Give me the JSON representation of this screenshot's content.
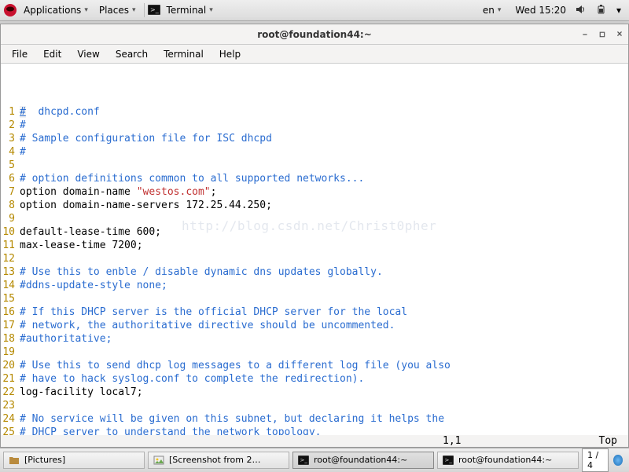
{
  "panel": {
    "applications": "Applications",
    "places": "Places",
    "terminal": "Terminal",
    "lang": "en",
    "clock": "Wed 15:20"
  },
  "window": {
    "title": "root@foundation44:~",
    "menu": {
      "file": "File",
      "edit": "Edit",
      "view": "View",
      "search": "Search",
      "terminal": "Terminal",
      "help": "Help"
    },
    "btn": {
      "min": "–",
      "max": "◻",
      "close": "×"
    }
  },
  "vim": {
    "status_pos": "1,1",
    "status_top": "Top",
    "watermark": "http://blog.csdn.net/Christ0pher",
    "lines": [
      {
        "n": "1",
        "segs": [
          {
            "t": "#",
            "c": "comment cursor-cell"
          },
          {
            "t": "  dhcpd.conf",
            "c": "comment"
          }
        ]
      },
      {
        "n": "2",
        "segs": [
          {
            "t": "#",
            "c": "comment"
          }
        ]
      },
      {
        "n": "3",
        "segs": [
          {
            "t": "# Sample configuration file for ISC dhcpd",
            "c": "comment"
          }
        ]
      },
      {
        "n": "4",
        "segs": [
          {
            "t": "#",
            "c": "comment"
          }
        ]
      },
      {
        "n": "5",
        "segs": [
          {
            "t": " ",
            "c": ""
          }
        ]
      },
      {
        "n": "6",
        "segs": [
          {
            "t": "# option definitions common to all supported networks...",
            "c": "comment"
          }
        ]
      },
      {
        "n": "7",
        "segs": [
          {
            "t": "option domain-name ",
            "c": ""
          },
          {
            "t": "\"westos.com\"",
            "c": "string"
          },
          {
            "t": ";",
            "c": ""
          }
        ]
      },
      {
        "n": "8",
        "segs": [
          {
            "t": "option domain-name-servers 172.25.44.250;",
            "c": ""
          }
        ]
      },
      {
        "n": "9",
        "segs": [
          {
            "t": " ",
            "c": ""
          }
        ]
      },
      {
        "n": "10",
        "segs": [
          {
            "t": "default-lease-time 600;",
            "c": ""
          }
        ]
      },
      {
        "n": "11",
        "segs": [
          {
            "t": "max-lease-time 7200;",
            "c": ""
          }
        ]
      },
      {
        "n": "12",
        "segs": [
          {
            "t": " ",
            "c": ""
          }
        ]
      },
      {
        "n": "13",
        "segs": [
          {
            "t": "# Use this to enble / disable dynamic dns updates globally.",
            "c": "comment"
          }
        ]
      },
      {
        "n": "14",
        "segs": [
          {
            "t": "#ddns-update-style none;",
            "c": "comment"
          }
        ]
      },
      {
        "n": "15",
        "segs": [
          {
            "t": " ",
            "c": ""
          }
        ]
      },
      {
        "n": "16",
        "segs": [
          {
            "t": "# If this DHCP server is the official DHCP server for the local",
            "c": "comment"
          }
        ]
      },
      {
        "n": "17",
        "segs": [
          {
            "t": "# network, the authoritative directive should be uncommented.",
            "c": "comment"
          }
        ]
      },
      {
        "n": "18",
        "segs": [
          {
            "t": "#authoritative;",
            "c": "comment"
          }
        ]
      },
      {
        "n": "19",
        "segs": [
          {
            "t": " ",
            "c": ""
          }
        ]
      },
      {
        "n": "20",
        "segs": [
          {
            "t": "# Use this to send dhcp log messages to a different log file (you also",
            "c": "comment"
          }
        ]
      },
      {
        "n": "21",
        "segs": [
          {
            "t": "# have to hack syslog.conf to complete the redirection).",
            "c": "comment"
          }
        ]
      },
      {
        "n": "22",
        "segs": [
          {
            "t": "log-facility local7;",
            "c": ""
          }
        ]
      },
      {
        "n": "23",
        "segs": [
          {
            "t": " ",
            "c": ""
          }
        ]
      },
      {
        "n": "24",
        "segs": [
          {
            "t": "# No service will be given on this subnet, but declaring it helps the",
            "c": "comment"
          }
        ]
      },
      {
        "n": "25",
        "segs": [
          {
            "t": "# DHCP server to understand the network topology.",
            "c": "comment"
          }
        ]
      }
    ]
  },
  "taskbar": {
    "tasks": [
      {
        "label": "[Pictures]",
        "icon": "folder"
      },
      {
        "label": "[Screenshot from 2…",
        "icon": "image"
      },
      {
        "label": "root@foundation44:~",
        "icon": "term",
        "active": true
      },
      {
        "label": "root@foundation44:~",
        "icon": "term"
      }
    ],
    "pager": "1 / 4"
  }
}
